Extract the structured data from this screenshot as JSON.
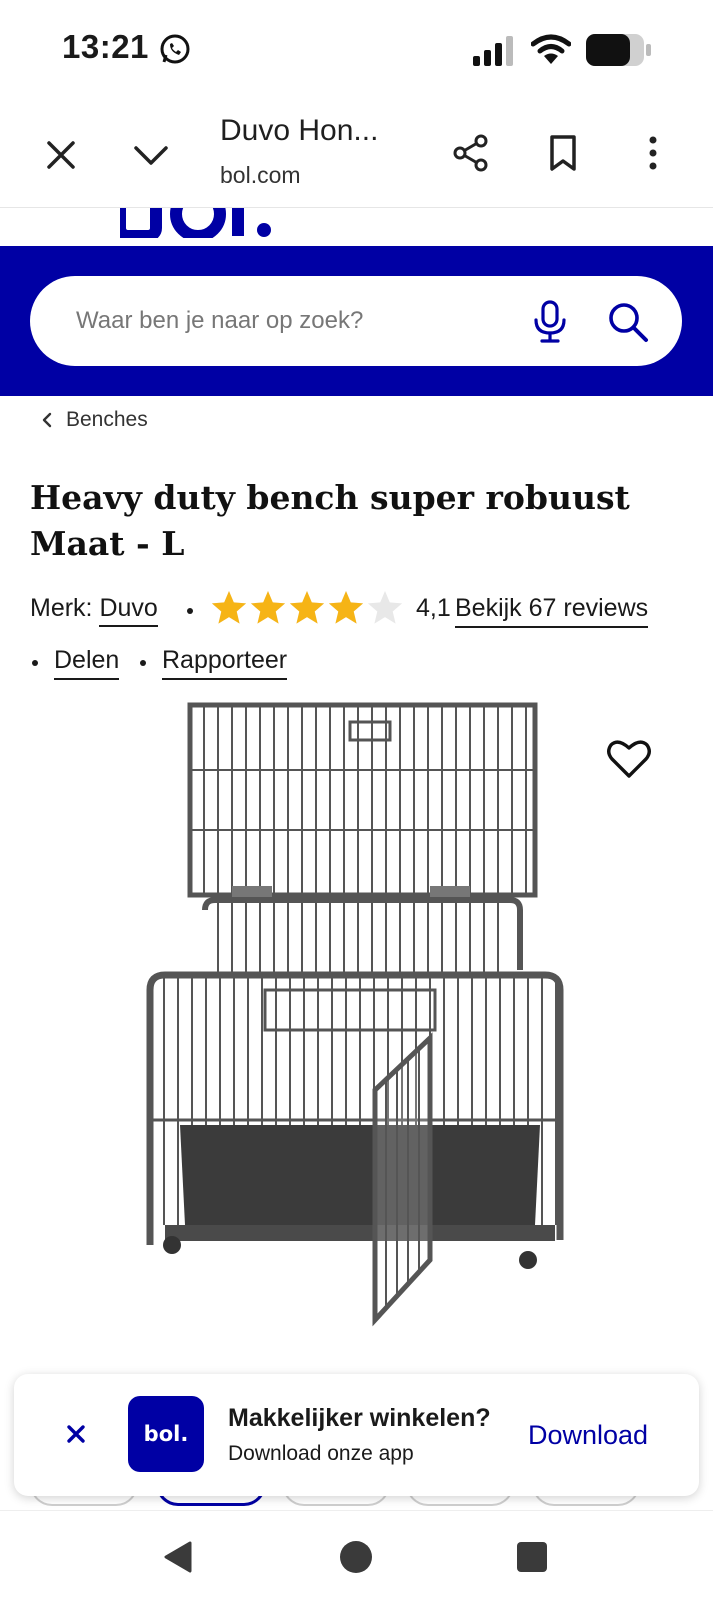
{
  "status_bar": {
    "time": "13:21",
    "icons": [
      "whatsapp-icon",
      "signal-icon",
      "wifi-icon",
      "battery-icon"
    ]
  },
  "toolbar": {
    "title": "Duvo Hon...",
    "url": "bol.com",
    "icons": [
      "close-icon",
      "chevron-down-icon",
      "share-icon",
      "bookmark-icon",
      "more-vert-icon"
    ]
  },
  "header": {
    "search_placeholder": "Waar ben je naar op zoek?",
    "brand_color": "#0000a4"
  },
  "breadcrumb": {
    "label": "Benches"
  },
  "product": {
    "title": "Heavy duty bench super robuust Maat - L",
    "brand_label": "Merk:",
    "brand_name": "Duvo",
    "rating_value": "4,1",
    "rating_fraction": 0.82,
    "star_color": "#f6b416",
    "reviews_link": "Bekijk 67 reviews",
    "share_link": "Delen",
    "report_link": "Rapporteer"
  },
  "app_banner": {
    "logo_text": "bol.",
    "title": "Makkelijker winkelen?",
    "subtitle": "Download onze app",
    "cta": "Download"
  },
  "nav": {
    "icons": [
      "back-icon",
      "home-icon",
      "recents-icon"
    ]
  }
}
